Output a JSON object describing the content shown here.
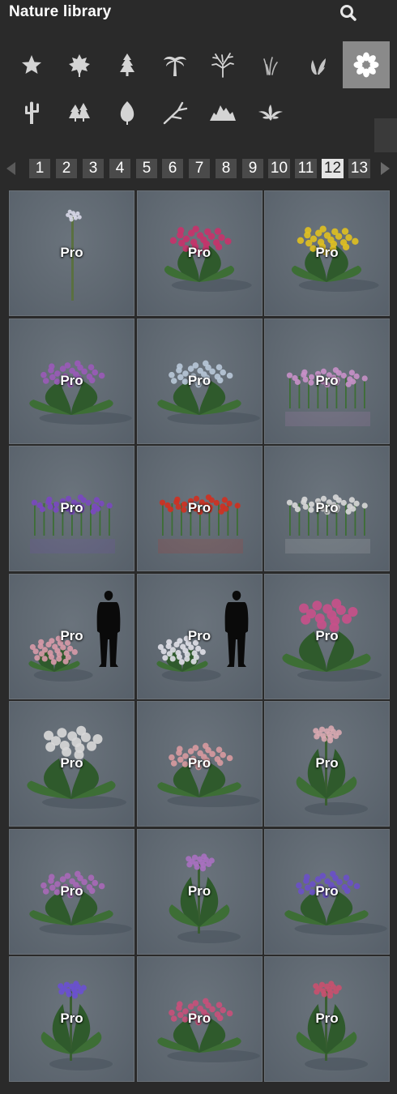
{
  "header": {
    "title": "Nature library",
    "search_icon": "search-icon"
  },
  "categories": [
    {
      "id": "favorites",
      "icon": "star-icon"
    },
    {
      "id": "leaves",
      "icon": "maple-leaf-icon"
    },
    {
      "id": "conifers",
      "icon": "pine-tree-icon"
    },
    {
      "id": "palms",
      "icon": "palm-tree-icon"
    },
    {
      "id": "bare-trees",
      "icon": "bare-tree-icon"
    },
    {
      "id": "grass",
      "icon": "grass-icon"
    },
    {
      "id": "plants",
      "icon": "plant-leaves-icon"
    },
    {
      "id": "flowers",
      "icon": "flower-icon",
      "active": true
    },
    {
      "id": "cactus",
      "icon": "cactus-icon"
    },
    {
      "id": "forest",
      "icon": "forest-icon"
    },
    {
      "id": "leaf",
      "icon": "leaf-icon"
    },
    {
      "id": "branches",
      "icon": "branch-icon"
    },
    {
      "id": "rocks",
      "icon": "rocks-icon"
    },
    {
      "id": "ferns",
      "icon": "fern-icon"
    }
  ],
  "pagination": {
    "pages": [
      "1",
      "2",
      "3",
      "4",
      "5",
      "6",
      "7",
      "8",
      "9",
      "10",
      "11",
      "12",
      "13"
    ],
    "current": "12"
  },
  "tiles": [
    {
      "badge": "Pro",
      "flower": "#d8d8e8",
      "type": "stem"
    },
    {
      "badge": "Pro",
      "flower": "#c8326a",
      "type": "bush"
    },
    {
      "badge": "Pro",
      "flower": "#e0c020",
      "type": "bush"
    },
    {
      "badge": "Pro",
      "flower": "#9a5ab8",
      "type": "wide"
    },
    {
      "badge": "Pro",
      "flower": "#b8c8d8",
      "type": "wide"
    },
    {
      "badge": "Pro",
      "flower": "#c890c8",
      "type": "row"
    },
    {
      "badge": "Pro",
      "flower": "#7a48c0",
      "type": "row"
    },
    {
      "badge": "Pro",
      "flower": "#d03020",
      "type": "row"
    },
    {
      "badge": "Pro",
      "flower": "#d8d8d8",
      "type": "row"
    },
    {
      "badge": "Pro",
      "flower": "#d89aa8",
      "type": "person"
    },
    {
      "badge": "Pro",
      "flower": "#e0e0e8",
      "type": "person"
    },
    {
      "badge": "Pro",
      "flower": "#c8508a",
      "type": "tall"
    },
    {
      "badge": "Pro",
      "flower": "#d8d8d8",
      "type": "tall"
    },
    {
      "badge": "Pro",
      "flower": "#d89aa0",
      "type": "wide"
    },
    {
      "badge": "Pro",
      "flower": "#d8a8b0",
      "type": "single"
    },
    {
      "badge": "Pro",
      "flower": "#a868b8",
      "type": "wide"
    },
    {
      "badge": "Pro",
      "flower": "#a870c0",
      "type": "single"
    },
    {
      "badge": "Pro",
      "flower": "#6a50c8",
      "type": "wide"
    },
    {
      "badge": "Pro",
      "flower": "#6a50d0",
      "type": "single"
    },
    {
      "badge": "Pro",
      "flower": "#c8507a",
      "type": "wide"
    },
    {
      "badge": "Pro",
      "flower": "#c8506e",
      "type": "single"
    }
  ]
}
